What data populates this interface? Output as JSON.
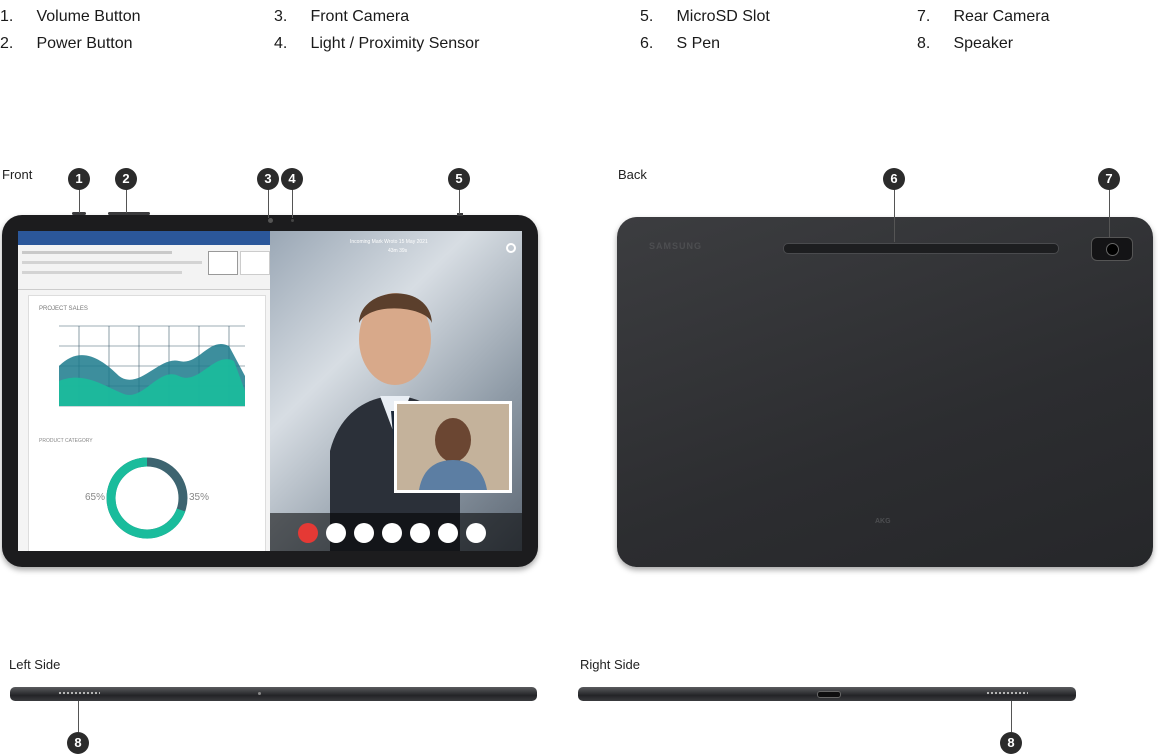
{
  "legend": [
    {
      "num": "1.",
      "label": "Volume Button"
    },
    {
      "num": "2.",
      "label": "Power Button"
    },
    {
      "num": "3.",
      "label": "Front Camera"
    },
    {
      "num": "4.",
      "label": "Light / Proximity Sensor"
    },
    {
      "num": "5.",
      "label": "MicroSD Slot"
    },
    {
      "num": "6.",
      "label": "S Pen"
    },
    {
      "num": "7.",
      "label": "Rear Camera"
    },
    {
      "num": "8.",
      "label": "Speaker"
    }
  ],
  "views": {
    "front": "Front",
    "back": "Back",
    "left_side": "Left Side",
    "right_side": "Right Side"
  },
  "badges": [
    "1",
    "2",
    "3",
    "4",
    "5",
    "6",
    "7",
    "8",
    "8"
  ],
  "screen": {
    "chart_title": "PROJECT SALES",
    "donut_title": "PRODUCT CATEGORY",
    "donut_left": "65%",
    "donut_right": "35%",
    "notice": "Incoming Mark Wroto 15 May 2021",
    "notice_sub": "43m 39s"
  },
  "back_labels": {
    "brand": "SAMSUNG",
    "akg": "AKG"
  },
  "colors": {
    "badge": "#2b2b2b",
    "device_dark": "#2c2d30",
    "word_blue": "#2b579a",
    "chart_teal": "#1abc9c",
    "call_red": "#e53935",
    "call_blue": "#1e88e5"
  }
}
